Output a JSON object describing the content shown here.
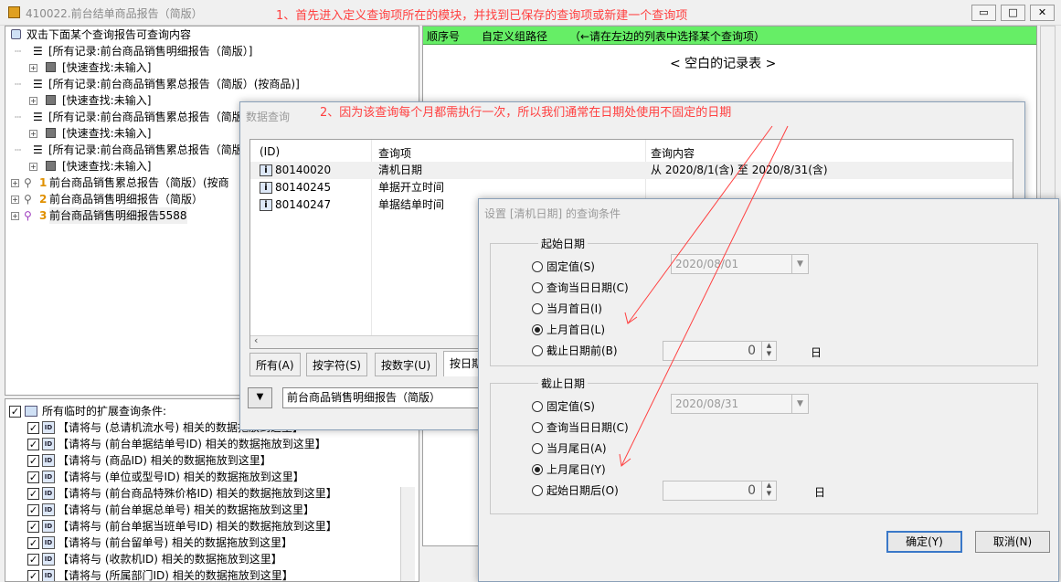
{
  "window": {
    "title": "410022.前台结单商品报告（简版）",
    "min_label": "▭",
    "max_label": "□",
    "close_label": "✕"
  },
  "annotations": {
    "step1": "1、首先进入定义查询项所在的模块，并找到已保存的查询项或新建一个查询项",
    "step2": "2、因为该查询每个月都需执行一次，所以我们通常在日期处使用不固定的日期"
  },
  "tree": {
    "root_label": "双击下面某个查询报告可查询内容",
    "items": [
      {
        "label": "[所有记录:前台商品销售明细报告（简版）]"
      },
      {
        "label": "[快速查找:未输入]"
      },
      {
        "label": "[所有记录:前台商品销售累总报告（简版）(按商品)]"
      },
      {
        "label": "[快速查找:未输入]"
      },
      {
        "label": "[所有记录:前台商品销售累总报告（简版"
      },
      {
        "label": "[快速查找:未输入]"
      },
      {
        "label": "[所有记录:前台商品销售累总报告（简版"
      },
      {
        "label": "[快速查找:未输入]"
      },
      {
        "num": "1",
        "label": "前台商品销售累总报告（简版）(按商"
      },
      {
        "num": "2",
        "label": "前台商品销售明细报告（简版）"
      },
      {
        "num": "3",
        "label": "前台商品销售明细报告5588"
      }
    ]
  },
  "conditions": {
    "header": "所有临时的扩展查询条件:",
    "items": [
      "【请将与 (总请机流水号) 相关的数据拖放到这里】",
      "【请将与 (前台单据结单号ID) 相关的数据拖放到这里】",
      "【请将与 (商品ID) 相关的数据拖放到这里】",
      "【请将与 (单位或型号ID) 相关的数据拖放到这里】",
      "【请将与 (前台商品特殊价格ID) 相关的数据拖放到这里】",
      "【请将与 (前台单据总单号) 相关的数据拖放到这里】",
      "【请将与 (前台单据当班单号ID) 相关的数据拖放到这里】",
      "【请将与 (前台留单号) 相关的数据拖放到这里】",
      "【请将与 (收款机ID) 相关的数据拖放到这里】",
      "【请将与 (所属部门ID) 相关的数据拖放到这里】"
    ],
    "check_mark": "✓",
    "id_icon_text": "ID"
  },
  "right_panel": {
    "col1": "顺序号",
    "col2": "自定义组路径",
    "hint": "（←请在左边的列表中选择某个查询项）",
    "empty": "< 空白的记录表 >"
  },
  "query_dialog": {
    "title": "数据查询",
    "columns": [
      "(ID)",
      "查询项",
      "查询内容"
    ],
    "rows": [
      {
        "id": "80140020",
        "item": "清机日期",
        "content": "从 2020/8/1(含) 至 2020/8/31(含)"
      },
      {
        "id": "80140245",
        "item": "单据开立时间",
        "content": ""
      },
      {
        "id": "80140247",
        "item": "单据结单时间",
        "content": ""
      }
    ],
    "tabs": [
      "所有(A)",
      "按字符(S)",
      "按数字(U)",
      "按日期"
    ],
    "dropdown_symbol": "▼",
    "report_selected": "前台商品销售明细报告（简版）"
  },
  "condition_dialog": {
    "title": "设置 [清机日期] 的查询条件",
    "start": {
      "label": "起始日期",
      "options": [
        "固定值(S)",
        "查询当日日期(C)",
        "当月首日(I)",
        "上月首日(L)",
        "截止日期前(B)"
      ],
      "selected_index": 3,
      "date_value": "2020/08/01",
      "spin_value": "0",
      "unit": "日"
    },
    "end": {
      "label": "截止日期",
      "options": [
        "固定值(S)",
        "查询当日日期(C)",
        "当月尾日(A)",
        "上月尾日(Y)",
        "起始日期后(O)"
      ],
      "selected_index": 3,
      "date_value": "2020/08/31",
      "spin_value": "0",
      "unit": "日"
    },
    "ok_label": "确定(Y)",
    "cancel_label": "取消(N)"
  },
  "colors": {
    "annotation": "#ff4040",
    "header_green": "#66ee66",
    "selected_row": "#f0f0f0"
  }
}
